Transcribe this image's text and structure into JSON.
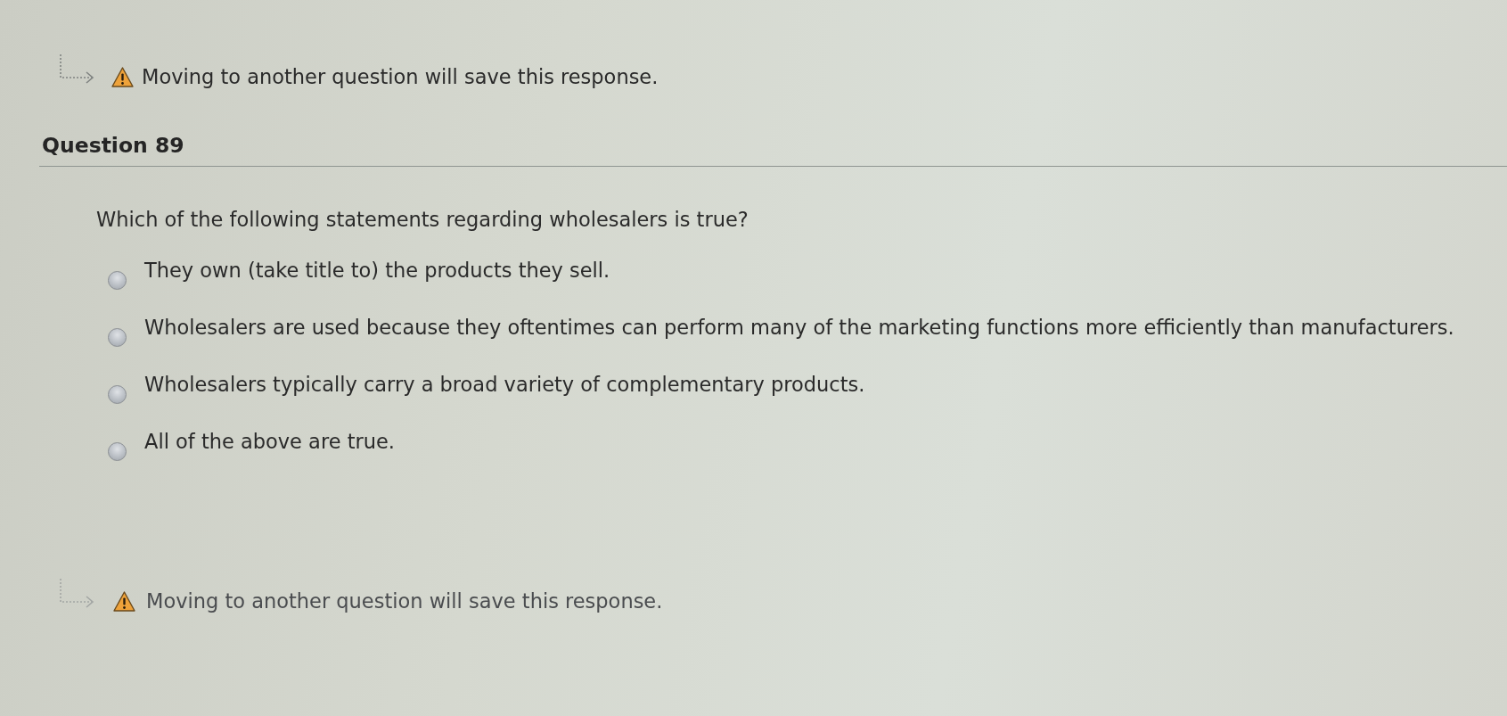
{
  "notice_top": {
    "text": "Moving to another question will save this response."
  },
  "question": {
    "title": "Question 89",
    "prompt": "Which of the following statements regarding wholesalers is true?",
    "options": [
      {
        "label": "They own (take title to) the products they sell.",
        "selected": false
      },
      {
        "label": "Wholesalers are used because they oftentimes can perform many of the marketing functions more efficiently than manufacturers.",
        "selected": false
      },
      {
        "label": "Wholesalers typically carry a broad variety of complementary products.",
        "selected": false
      },
      {
        "label": "All of the above are true.",
        "selected": false
      }
    ]
  },
  "notice_bottom": {
    "text": "Moving to another question will save this response."
  }
}
